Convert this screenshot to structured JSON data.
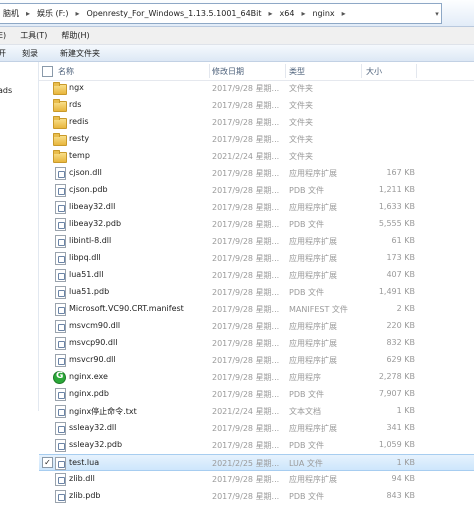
{
  "address": {
    "crumbs": [
      "脑机",
      "娱乐 (F:)",
      "Openresty_For_Windows_1.13.5.1001_64Bit",
      "x64",
      "nginx"
    ]
  },
  "menu": [
    "E)",
    "工具(T)",
    "帮助(H)"
  ],
  "toolbar": {
    "left_label": "开",
    "burn_label": "刻录",
    "new_folder_label": "新建文件夹"
  },
  "nav": {
    "item": "ads"
  },
  "columns": {
    "name": "名称",
    "date": "修改日期",
    "type": "类型",
    "size": "大小"
  },
  "rows": [
    {
      "name": "ngx",
      "date": "2017/9/28 星期...",
      "type": "文件夹",
      "size": "",
      "kind": "folder"
    },
    {
      "name": "rds",
      "date": "2017/9/28 星期...",
      "type": "文件夹",
      "size": "",
      "kind": "folder"
    },
    {
      "name": "redis",
      "date": "2017/9/28 星期...",
      "type": "文件夹",
      "size": "",
      "kind": "folder"
    },
    {
      "name": "resty",
      "date": "2017/9/28 星期...",
      "type": "文件夹",
      "size": "",
      "kind": "folder"
    },
    {
      "name": "temp",
      "date": "2021/2/24 星期...",
      "type": "文件夹",
      "size": "",
      "kind": "folder"
    },
    {
      "name": "cjson.dll",
      "date": "2017/9/28 星期...",
      "type": "应用程序扩展",
      "size": "167 KB",
      "kind": "file"
    },
    {
      "name": "cjson.pdb",
      "date": "2017/9/28 星期...",
      "type": "PDB 文件",
      "size": "1,211 KB",
      "kind": "file"
    },
    {
      "name": "libeay32.dll",
      "date": "2017/9/28 星期...",
      "type": "应用程序扩展",
      "size": "1,633 KB",
      "kind": "file"
    },
    {
      "name": "libeay32.pdb",
      "date": "2017/9/28 星期...",
      "type": "PDB 文件",
      "size": "5,555 KB",
      "kind": "file"
    },
    {
      "name": "libintl-8.dll",
      "date": "2017/9/28 星期...",
      "type": "应用程序扩展",
      "size": "61 KB",
      "kind": "file"
    },
    {
      "name": "libpq.dll",
      "date": "2017/9/28 星期...",
      "type": "应用程序扩展",
      "size": "173 KB",
      "kind": "file"
    },
    {
      "name": "lua51.dll",
      "date": "2017/9/28 星期...",
      "type": "应用程序扩展",
      "size": "407 KB",
      "kind": "file"
    },
    {
      "name": "lua51.pdb",
      "date": "2017/9/28 星期...",
      "type": "PDB 文件",
      "size": "1,491 KB",
      "kind": "file"
    },
    {
      "name": "Microsoft.VC90.CRT.manifest",
      "date": "2017/9/28 星期...",
      "type": "MANIFEST 文件",
      "size": "2 KB",
      "kind": "file"
    },
    {
      "name": "msvcm90.dll",
      "date": "2017/9/28 星期...",
      "type": "应用程序扩展",
      "size": "220 KB",
      "kind": "file"
    },
    {
      "name": "msvcp90.dll",
      "date": "2017/9/28 星期...",
      "type": "应用程序扩展",
      "size": "832 KB",
      "kind": "file"
    },
    {
      "name": "msvcr90.dll",
      "date": "2017/9/28 星期...",
      "type": "应用程序扩展",
      "size": "629 KB",
      "kind": "file"
    },
    {
      "name": "nginx.exe",
      "date": "2017/9/28 星期...",
      "type": "应用程序",
      "size": "2,278 KB",
      "kind": "exe"
    },
    {
      "name": "nginx.pdb",
      "date": "2017/9/28 星期...",
      "type": "PDB 文件",
      "size": "7,907 KB",
      "kind": "file"
    },
    {
      "name": "nginx停止命令.txt",
      "date": "2021/2/24 星期...",
      "type": "文本文档",
      "size": "1 KB",
      "kind": "file"
    },
    {
      "name": "ssleay32.dll",
      "date": "2017/9/28 星期...",
      "type": "应用程序扩展",
      "size": "341 KB",
      "kind": "file"
    },
    {
      "name": "ssleay32.pdb",
      "date": "2017/9/28 星期...",
      "type": "PDB 文件",
      "size": "1,059 KB",
      "kind": "file"
    },
    {
      "name": "test.lua",
      "date": "2021/2/25 星期...",
      "type": "LUA 文件",
      "size": "1 KB",
      "kind": "file",
      "selected": true
    },
    {
      "name": "zlib.dll",
      "date": "2017/9/28 星期...",
      "type": "应用程序扩展",
      "size": "94 KB",
      "kind": "file"
    },
    {
      "name": "zlib.pdb",
      "date": "2017/9/28 星期...",
      "type": "PDB 文件",
      "size": "843 KB",
      "kind": "file"
    }
  ]
}
